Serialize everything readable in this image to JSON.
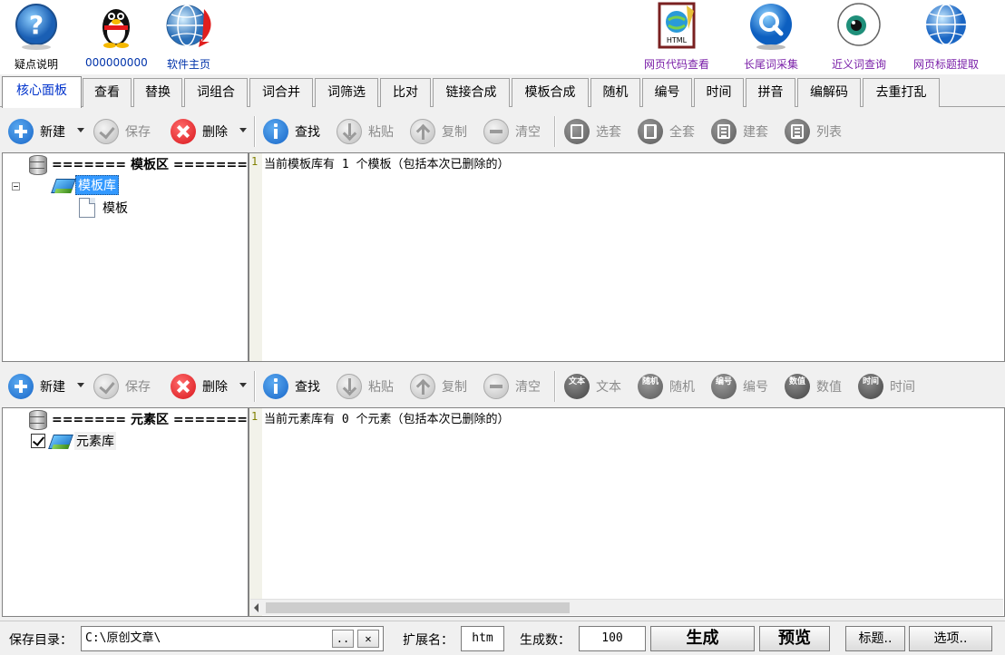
{
  "topbar": {
    "items": [
      {
        "label": "疑点说明",
        "icon": "help-icon"
      },
      {
        "label": "000000000",
        "icon": "qq-penguin-icon"
      },
      {
        "label": "软件主页",
        "icon": "globe-home-icon"
      },
      {
        "label": "网页代码查看",
        "icon": "html-document-icon"
      },
      {
        "label": "长尾词采集",
        "icon": "magnifier-icon"
      },
      {
        "label": "近义词查询",
        "icon": "eye-icon"
      },
      {
        "label": "网页标题提取",
        "icon": "globe-icon"
      }
    ]
  },
  "tabs": [
    {
      "label": "核心面板",
      "active": true
    },
    {
      "label": "查看"
    },
    {
      "label": "替换"
    },
    {
      "label": "词组合"
    },
    {
      "label": "词合并"
    },
    {
      "label": "词筛选"
    },
    {
      "label": "比对"
    },
    {
      "label": "链接合成"
    },
    {
      "label": "模板合成"
    },
    {
      "label": "随机"
    },
    {
      "label": "编号"
    },
    {
      "label": "时间"
    },
    {
      "label": "拼音"
    },
    {
      "label": "编解码"
    },
    {
      "label": "去重打乱"
    }
  ],
  "toolbar1": {
    "new": "新建",
    "save": "保存",
    "delete": "删除",
    "find": "查找",
    "paste": "粘贴",
    "copy": "复制",
    "clear": "清空",
    "select_set": "选套",
    "full_set": "全套",
    "build_set": "建套",
    "list": "列表"
  },
  "toolbar2": {
    "new": "新建",
    "save": "保存",
    "delete": "删除",
    "find": "查找",
    "paste": "粘贴",
    "copy": "复制",
    "clear": "清空",
    "text": "文本",
    "random": "随机",
    "number": "编号",
    "value": "数值",
    "time": "时间",
    "text_glyph": "文本",
    "random_glyph": "随机",
    "number_glyph": "编号",
    "value_glyph": "数值",
    "time_glyph": "时间"
  },
  "template_pane": {
    "root": "======= 模板区 =======",
    "library": "模板库",
    "child": "模板",
    "line_no": "1",
    "line_text": "当前模板库有 1 个模板（包括本次已删除的）"
  },
  "element_pane": {
    "root": "======= 元素区 =======",
    "library": "元素库",
    "library_checked": true,
    "line_no": "1",
    "line_text": "当前元素库有 0 个元素（包括本次已删除的）"
  },
  "statusbar": {
    "save_dir_label": "保存目录：",
    "save_dir_value": "C:\\原创文章\\",
    "browse_btn": "..",
    "clear_btn": "✕",
    "ext_label": "扩展名：",
    "ext_value": "htm",
    "count_label": "生成数：",
    "count_value": "100",
    "generate_btn": "生成",
    "preview_btn": "预览",
    "title_btn": "标题..",
    "options_btn": "选项.."
  },
  "colors": {
    "active_tab_text": "#0033cc",
    "selection": "#3399ff",
    "label_blue": "#0033aa",
    "label_purple": "#7a1fa8"
  }
}
